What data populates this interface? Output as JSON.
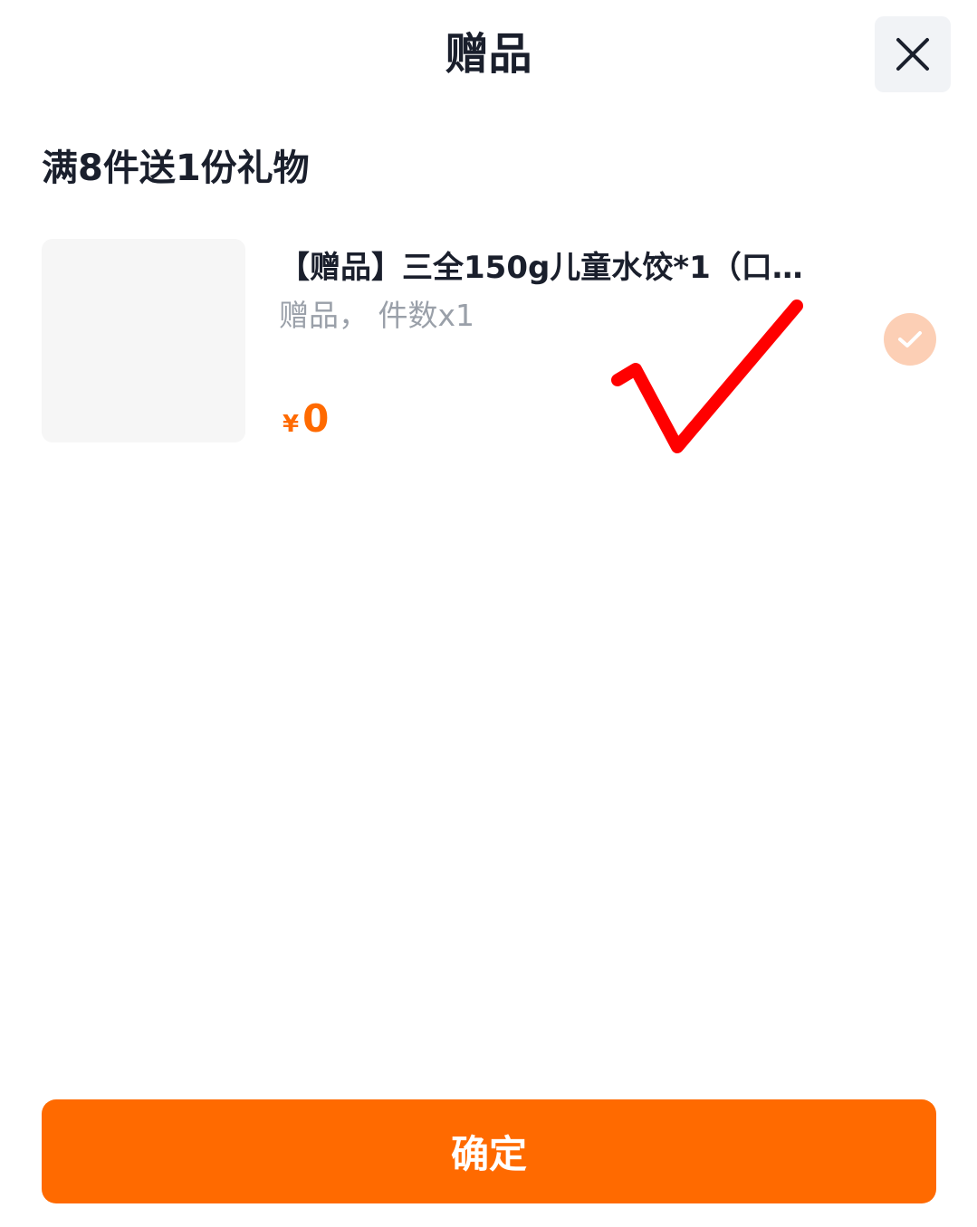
{
  "header": {
    "title": "赠品",
    "close_icon": "close-icon"
  },
  "promo": {
    "title": "满8件送1份礼物"
  },
  "items": [
    {
      "title": "【赠品】三全150g儿童水饺*1（口…",
      "subtitle": "赠品，  件数x1",
      "currency": "¥",
      "price": "0",
      "selected": true
    }
  ],
  "colors": {
    "accent": "#ff6a00",
    "selected_check_bg": "#fccfb5",
    "annotation": "#ff0000",
    "text_primary": "#1a1f2c",
    "text_secondary": "#9aa0a9"
  },
  "footer": {
    "confirm_label": "确定"
  }
}
